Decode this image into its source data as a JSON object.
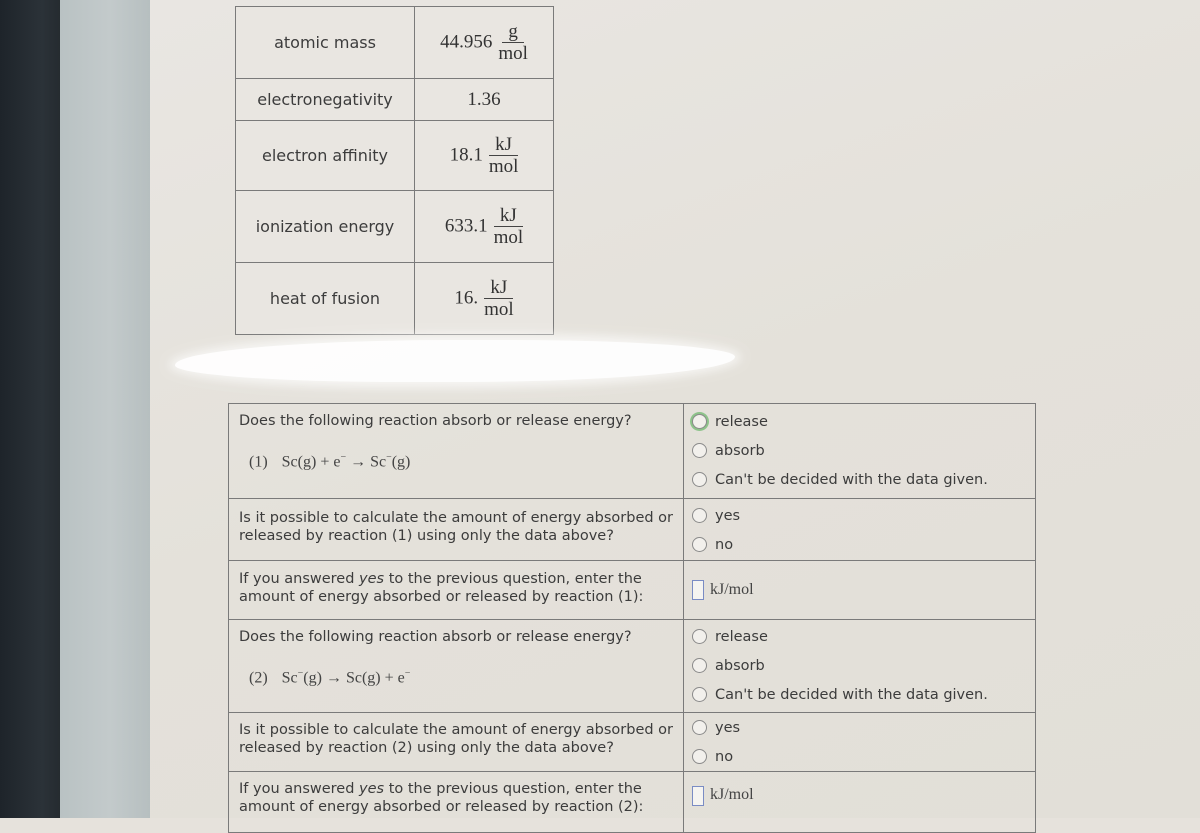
{
  "properties_table": [
    {
      "label": "atomic mass",
      "value": "44.956",
      "unit_num": "g",
      "unit_den": "mol"
    },
    {
      "label": "electronegativity",
      "value": "1.36",
      "unit_num": "",
      "unit_den": ""
    },
    {
      "label": "electron affinity",
      "value": "18.1",
      "unit_num": "kJ",
      "unit_den": "mol"
    },
    {
      "label": "ionization energy",
      "value": "633.1",
      "unit_num": "kJ",
      "unit_den": "mol"
    },
    {
      "label": "heat of fusion",
      "value": "16.",
      "unit_num": "kJ",
      "unit_den": "mol"
    }
  ],
  "reaction1": {
    "question": "Does the following reaction absorb or release energy?",
    "number": "(1)",
    "lhs": "Sc(g) + e",
    "lhs_sup": "−",
    "arrow": "→",
    "rhs": "Sc",
    "rhs_sup": "−",
    "rhs_state": "(g)",
    "options": [
      "release",
      "absorb",
      "Can't be decided with the data given."
    ],
    "focused_option": "release",
    "calc_question": "Is it possible to calculate the amount of energy absorbed or released by reaction (1) using only the data above?",
    "calc_options": [
      "yes",
      "no"
    ],
    "enter_prefix": "If you answered ",
    "enter_emph": "yes",
    "enter_suffix": " to the previous question, enter the amount of energy absorbed or released by reaction (1):",
    "answer_value": "",
    "answer_unit": "kJ/mol"
  },
  "reaction2": {
    "question": "Does the following reaction absorb or release energy?",
    "number": "(2)",
    "lhs": "Sc",
    "lhs_sup": "−",
    "lhs_state": "(g)",
    "arrow": "→",
    "rhs": "Sc(g) + e",
    "rhs_sup": "−",
    "options": [
      "release",
      "absorb",
      "Can't be decided with the data given."
    ],
    "calc_question": "Is it possible to calculate the amount of energy absorbed or released by reaction (2) using only the data above?",
    "calc_options": [
      "yes",
      "no"
    ],
    "enter_prefix": "If you answered ",
    "enter_emph": "yes",
    "enter_suffix": " to the previous question, enter the amount of energy absorbed or released by reaction (2):",
    "answer_value": "",
    "answer_unit": "kJ/mol"
  }
}
